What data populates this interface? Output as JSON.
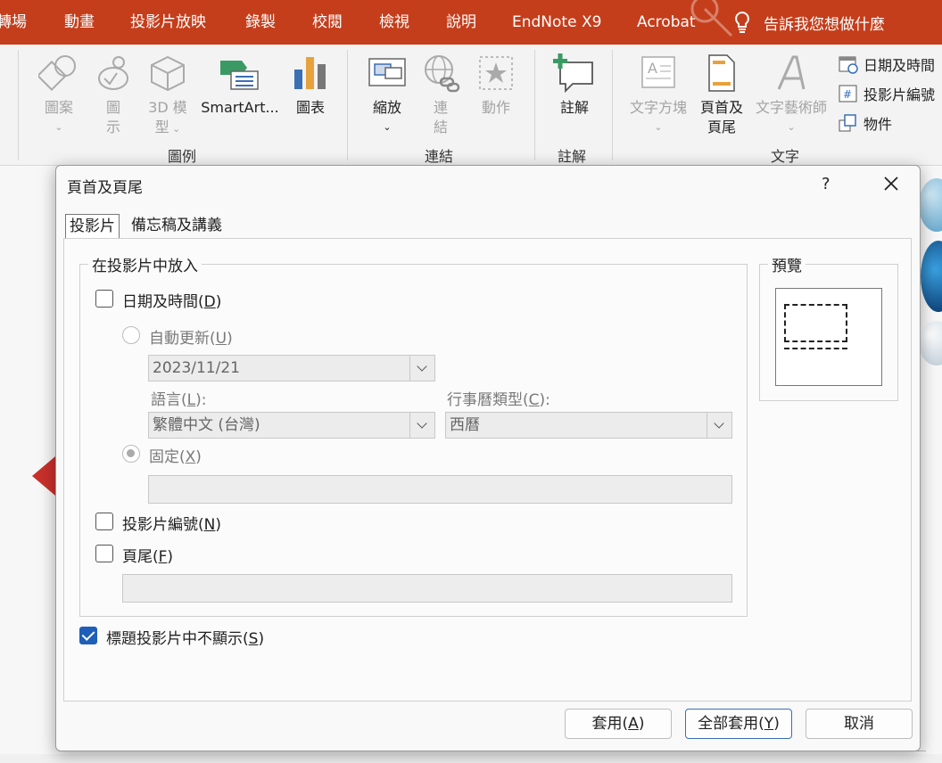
{
  "menu": {
    "tabs": [
      "轉場",
      "動畫",
      "投影片放映",
      "錄製",
      "校閱",
      "檢視",
      "說明",
      "EndNote X9",
      "Acrobat"
    ],
    "tell_me": "告訴我您想做什麼"
  },
  "ribbon": {
    "illustrations": {
      "group_label": "圖例",
      "shapes": "圖案",
      "icons_l1": "圖",
      "icons_l2": "示",
      "models_l1": "3D 模",
      "models_l2": "型",
      "smartart": "SmartArt...",
      "chart": "圖表"
    },
    "links": {
      "group_label": "連結",
      "zoom": "縮放",
      "link_l1": "連",
      "link_l2": "結",
      "action": "動作"
    },
    "comments": {
      "group_label": "註解",
      "comment": "註解"
    },
    "text": {
      "group_label": "文字",
      "textbox": "文字方塊",
      "header_footer_l1": "頁首及",
      "header_footer_l2": "頁尾",
      "wordart": "文字藝術師",
      "date_time": "日期及時間",
      "slide_number": "投影片編號",
      "object": "物件"
    }
  },
  "dialog": {
    "title": "頁首及頁尾",
    "help": "?",
    "tabs": [
      "投影片",
      "備忘稿及講義"
    ],
    "include_group": "在投影片中放入",
    "date_time": {
      "label_pre": "日期及時間(",
      "key": "D",
      "label_post": ")",
      "checked": false
    },
    "auto_update": {
      "label_pre": "自動更新(",
      "key": "U",
      "label_post": ")"
    },
    "date_value": "2023/11/21",
    "language": {
      "label_pre": "語言(",
      "key": "L",
      "label_post": "):",
      "value": "繁體中文 (台灣)"
    },
    "calendar": {
      "label_pre": "行事曆類型(",
      "key": "C",
      "label_post": "):",
      "value": "西曆"
    },
    "fixed": {
      "label_pre": "固定(",
      "key": "X",
      "label_post": ")"
    },
    "slide_number": {
      "label_pre": "投影片編號(",
      "key": "N",
      "label_post": ")",
      "checked": false
    },
    "footer": {
      "label_pre": "頁尾(",
      "key": "F",
      "label_post": ")",
      "checked": false
    },
    "dont_show_title": {
      "label_pre": "標題投影片中不顯示(",
      "key": "S",
      "label_post": ")",
      "checked": true
    },
    "preview_label": "預覽",
    "buttons": {
      "apply": {
        "pre": "套用(",
        "key": "A",
        "post": ")"
      },
      "apply_all": {
        "pre": "全部套用(",
        "key": "Y",
        "post": ")"
      },
      "cancel": "取消"
    }
  },
  "colors": {
    "menubar": "#c43e1c",
    "accent": "#1d5fb9"
  }
}
